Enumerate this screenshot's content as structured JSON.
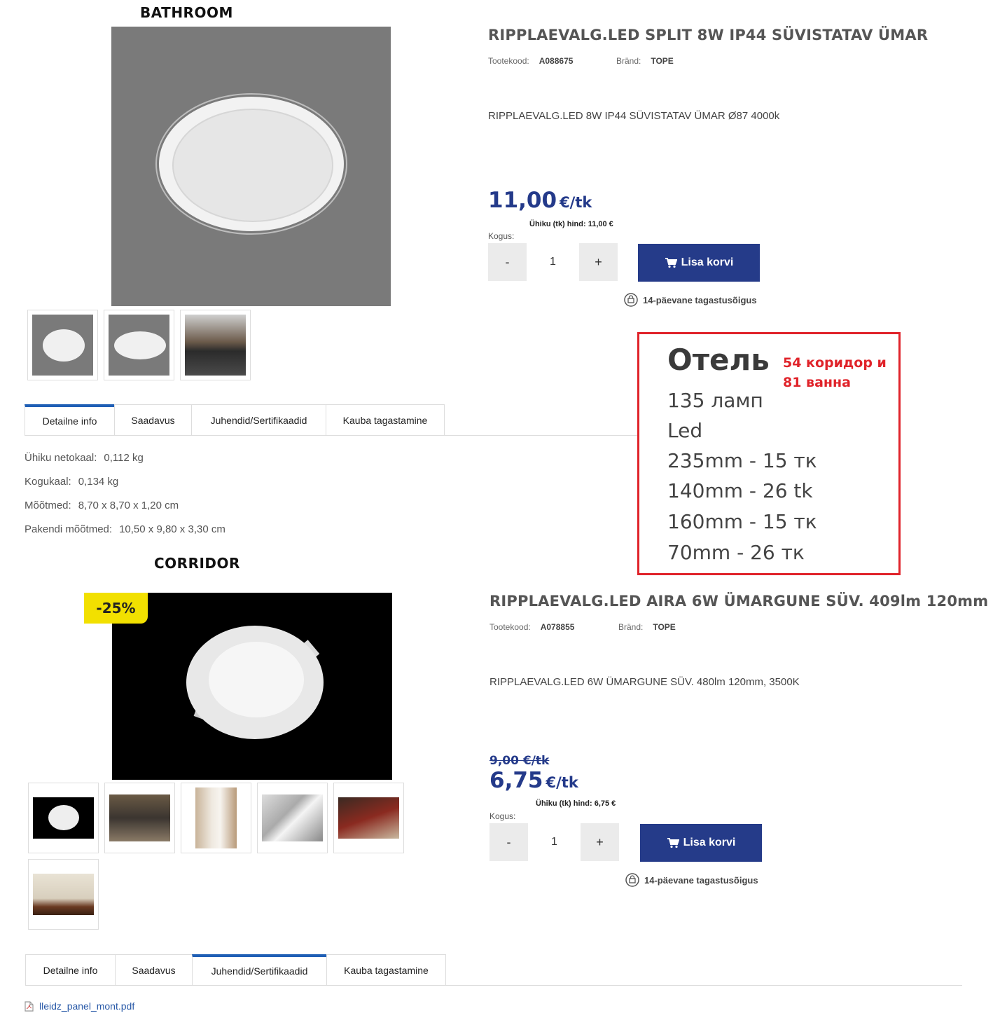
{
  "labels": {
    "bathroom": "BATHROOM",
    "corridor": "CORRIDOR"
  },
  "product1": {
    "title": "RIPPLAEVALG.LED SPLIT 8W IP44 SÜVISTATAV ÜMAR",
    "code_label": "Tootekood:",
    "code": "A088675",
    "brand_label": "Bränd:",
    "brand": "TOPE",
    "description": "RIPPLAEVALG.LED 8W IP44 SÜVISTATAV ÜMAR Ø87 4000k",
    "price": "11,00",
    "price_unit": "€/tk",
    "unit_price": "Ühiku (tk) hind: 11,00 €",
    "qty_label": "Kogus:",
    "qty_minus": "-",
    "qty_value": "1",
    "qty_plus": "+",
    "cart": "Lisa korvi",
    "returns": "14-päevane tagastusõigus",
    "tabs": [
      "Detailne info",
      "Saadavus",
      "Juhendid/Sertifikaadid",
      "Kauba tagastamine"
    ],
    "specs": [
      {
        "label": "Ühiku netokaal:",
        "value": "0,112 kg"
      },
      {
        "label": "Kogukaal:",
        "value": "0,134 kg"
      },
      {
        "label": "Mõõtmed:",
        "value": "8,70 x 8,70 x 1,20 cm"
      },
      {
        "label": "Pakendi mõõtmed:",
        "value": "10,50 x 9,80 x 3,30 cm"
      }
    ]
  },
  "product2": {
    "badge": "-25%",
    "title": "RIPPLAEVALG.LED AIRA 6W ÜMARGUNE SÜV. 409lm 120mm",
    "code_label": "Tootekood:",
    "code": "A078855",
    "brand_label": "Bränd:",
    "brand": "TOPE",
    "description": "RIPPLAEVALG.LED 6W ÜMARGUNE SÜV. 480lm 120mm, 3500K",
    "old_price": "9,00 €/tk",
    "price": "6,75",
    "price_unit": "€/tk",
    "unit_price": "Ühiku (tk) hind: 6,75 €",
    "qty_label": "Kogus:",
    "qty_minus": "-",
    "qty_value": "1",
    "qty_plus": "+",
    "cart": "Lisa korvi",
    "returns": "14-päevane tagastusõigus",
    "tabs": [
      "Detailne info",
      "Saadavus",
      "Juhendid/Sertifikaadid",
      "Kauba tagastamine"
    ],
    "file": "lleidz_panel_mont.pdf"
  },
  "note": {
    "header": "Отель",
    "red_line1": "54 коридор и",
    "red_line2": "81 ванна",
    "lines": [
      "135 ламп",
      "Led",
      "235mm - 15 тк",
      "140mm - 26 tk",
      "160mm - 15 тк",
      "70mm - 26 тк"
    ]
  },
  "colors": {
    "accent": "#253b89",
    "tab_active": "#1f5fb5",
    "badge": "#f2e000",
    "note_border": "#e0232a"
  }
}
